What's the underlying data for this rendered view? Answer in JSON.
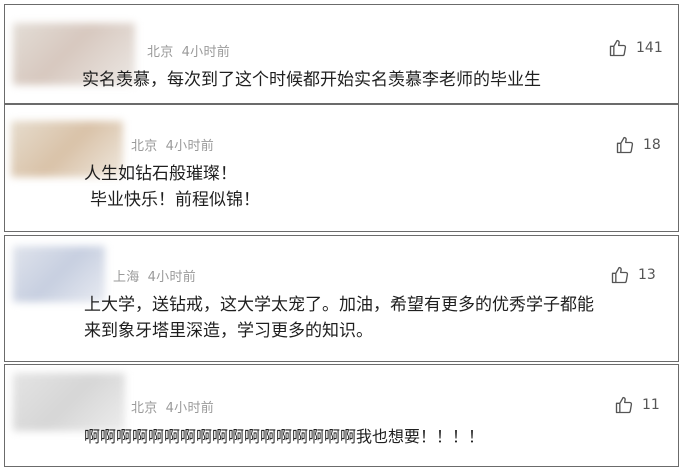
{
  "comments": [
    {
      "location": "北京",
      "time": "4小时前",
      "likes": "141",
      "lines": [
        "实名羡慕，每次到了这个时候都开始实名羡慕李老师的毕业生"
      ]
    },
    {
      "location": "北京",
      "time": "4小时前",
      "likes": "18",
      "lines": [
        "人生如钻石般璀璨！",
        "毕业快乐！前程似锦！"
      ]
    },
    {
      "location": "上海",
      "time": "4小时前",
      "likes": "13",
      "lines": [
        "上大学，送钻戒，这大学太宠了。加油，希望有更多的优秀学子都能",
        "来到象牙塔里深造，学习更多的知识。"
      ]
    },
    {
      "location": "北京",
      "time": "4小时前",
      "likes": "11",
      "lines": [
        "啊啊啊啊啊啊啊啊啊啊啊啊啊啊啊啊啊我也想要！！！！"
      ]
    }
  ]
}
